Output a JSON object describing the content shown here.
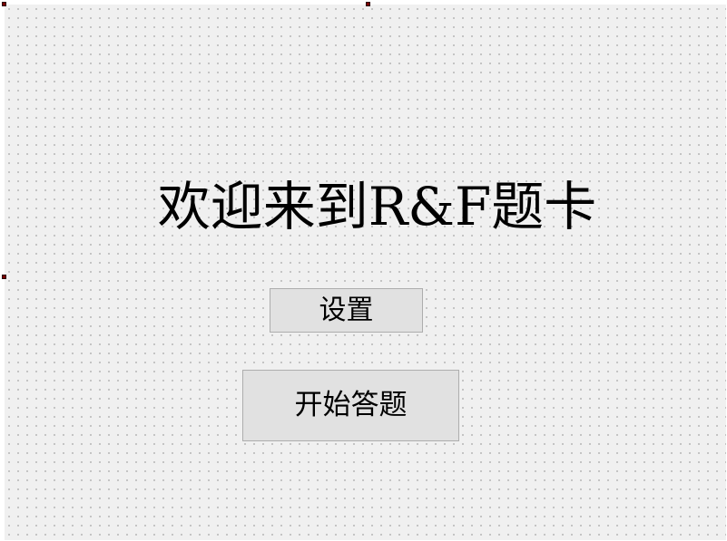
{
  "form": {
    "title": "欢迎来到R&F题卡"
  },
  "buttons": {
    "settings_label": "设置",
    "start_label": "开始答题"
  },
  "colors": {
    "canvas_background": "#f0f0f0",
    "button_background": "#e1e1e1",
    "selection_handle": "#7a0000"
  }
}
